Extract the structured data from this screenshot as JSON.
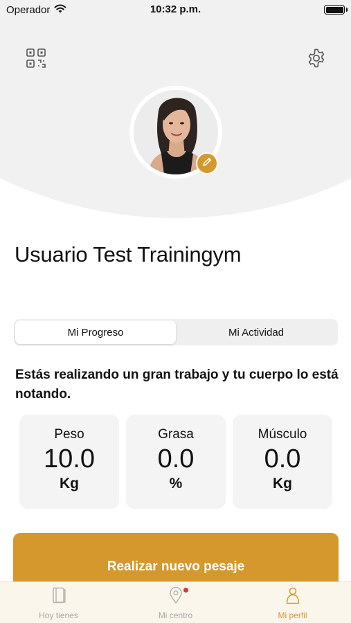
{
  "status_bar": {
    "carrier": "Operador",
    "time": "10:32 p.m."
  },
  "header": {
    "qr_icon": "qr-code-icon",
    "settings_icon": "gear-icon",
    "avatar_icon": "user-photo",
    "edit_icon": "pencil-icon"
  },
  "profile": {
    "name": "Usuario Test Trainingym"
  },
  "tabs_segment": {
    "items": [
      {
        "label": "Mi Progreso",
        "active": true
      },
      {
        "label": "Mi Actividad",
        "active": false
      }
    ]
  },
  "progress": {
    "message": "Estás realizando un gran trabajo y tu cuerpo lo está notando.",
    "stats": [
      {
        "label": "Peso",
        "value": "10.0",
        "unit": "Kg"
      },
      {
        "label": "Grasa",
        "value": "0.0",
        "unit": "%"
      },
      {
        "label": "Músculo",
        "value": "0.0",
        "unit": "Kg"
      }
    ],
    "cta_label": "Realizar nuevo pesaje"
  },
  "tab_bar": {
    "items": [
      {
        "label": "Hoy tienes",
        "icon": "notebook-icon",
        "active": false
      },
      {
        "label": "Mi centro",
        "icon": "location-pin-icon",
        "active": false,
        "badge": true
      },
      {
        "label": "Mi perfil",
        "icon": "person-icon",
        "active": true
      }
    ]
  },
  "colors": {
    "accent": "#d4982c",
    "header_bg": "#f1f1f1",
    "card_bg": "#f4f4f4",
    "badge": "#e0332a"
  }
}
